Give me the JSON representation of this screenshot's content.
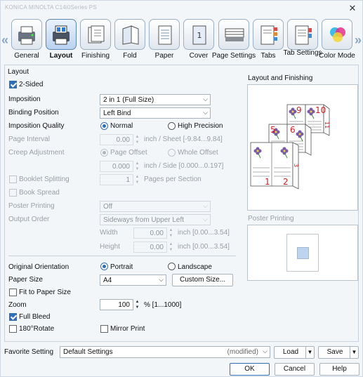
{
  "window": {
    "title": "KONICA MINOLTA C14i0Series PS",
    "close_glyph": "✕"
  },
  "tabs": [
    {
      "label": "General",
      "icon": "general-icon"
    },
    {
      "label": "Layout",
      "icon": "layout-icon",
      "active": true
    },
    {
      "label": "Finishing",
      "icon": "finishing-icon"
    },
    {
      "label": "Fold",
      "icon": "fold-icon"
    },
    {
      "label": "Paper",
      "icon": "paper-icon"
    },
    {
      "label": "Cover",
      "icon": "cover-icon"
    },
    {
      "label": "Page Settings",
      "icon": "page-settings-icon"
    },
    {
      "label": "Tabs",
      "icon": "tabs-icon"
    },
    {
      "label": "Tab Settings",
      "icon": "tab-settings-icon"
    },
    {
      "label": "Color Mode",
      "icon": "color-mode-icon"
    }
  ],
  "arrows": {
    "left": "«",
    "right": "»"
  },
  "layout": {
    "group_title": "Layout",
    "two_sided": {
      "label": "2-Sided",
      "checked": true
    },
    "imposition": {
      "label": "Imposition",
      "value": "2 in 1 (Full Size)"
    },
    "binding_position": {
      "label": "Binding Position",
      "value": "Left Bind"
    },
    "imposition_quality": {
      "label": "Imposition Quality",
      "options": [
        "Normal",
        "High Precision"
      ],
      "selected": "Normal"
    },
    "page_interval": {
      "label": "Page Interval",
      "value": "0.00",
      "unit": "inch / Sheet [-9.84...9.84]"
    },
    "creep_adjustment": {
      "label": "Creep Adjustment",
      "options": [
        "Page Offset",
        "Whole Offset"
      ],
      "selected": "Page Offset",
      "value": "0.000",
      "unit": "inch / Side [0.000...0.197]"
    },
    "booklet_splitting": {
      "label": "Booklet Splitting",
      "value": "1",
      "unit": "Pages per Section"
    },
    "book_spread": {
      "label": "Book Spread"
    },
    "poster_printing": {
      "label": "Poster Printing",
      "value": "Off"
    },
    "output_order": {
      "label": "Output Order",
      "value": "Sideways from Upper Left"
    },
    "width": {
      "label": "Width",
      "value": "0.00",
      "unit": "inch [0.00...3.54]"
    },
    "height": {
      "label": "Height",
      "value": "0.00",
      "unit": "inch [0.00...3.54]"
    },
    "original_orientation": {
      "label": "Original Orientation",
      "options": [
        "Portrait",
        "Landscape"
      ],
      "selected": "Portrait"
    },
    "paper_size": {
      "label": "Paper Size",
      "value": "A4",
      "custom_button": "Custom Size..."
    },
    "fit_to_paper_size": {
      "label": "Fit to Paper Size",
      "checked": false
    },
    "zoom": {
      "label": "Zoom",
      "value": "100",
      "unit": "% [1...1000]"
    },
    "full_bleed": {
      "label": "Full Bleed",
      "checked": true
    },
    "rotate_180": {
      "label": "180°Rotate",
      "checked": false
    },
    "mirror_print": {
      "label": "Mirror Print",
      "checked": false
    }
  },
  "preview": {
    "title": "Layout and Finishing",
    "page_numbers": [
      "1",
      "2",
      "5",
      "6",
      "9",
      "10",
      "11",
      "3"
    ],
    "poster_title": "Poster Printing"
  },
  "footer": {
    "favorite_label": "Favorite Setting",
    "favorite_value": "Default Settings",
    "favorite_modified": "(modified)",
    "load": "Load",
    "save": "Save",
    "ok": "OK",
    "cancel": "Cancel",
    "help": "Help"
  },
  "colors": {
    "accent": "#2f6fb8",
    "page_number": "#cc2222",
    "flower": "#7a5aa8"
  }
}
